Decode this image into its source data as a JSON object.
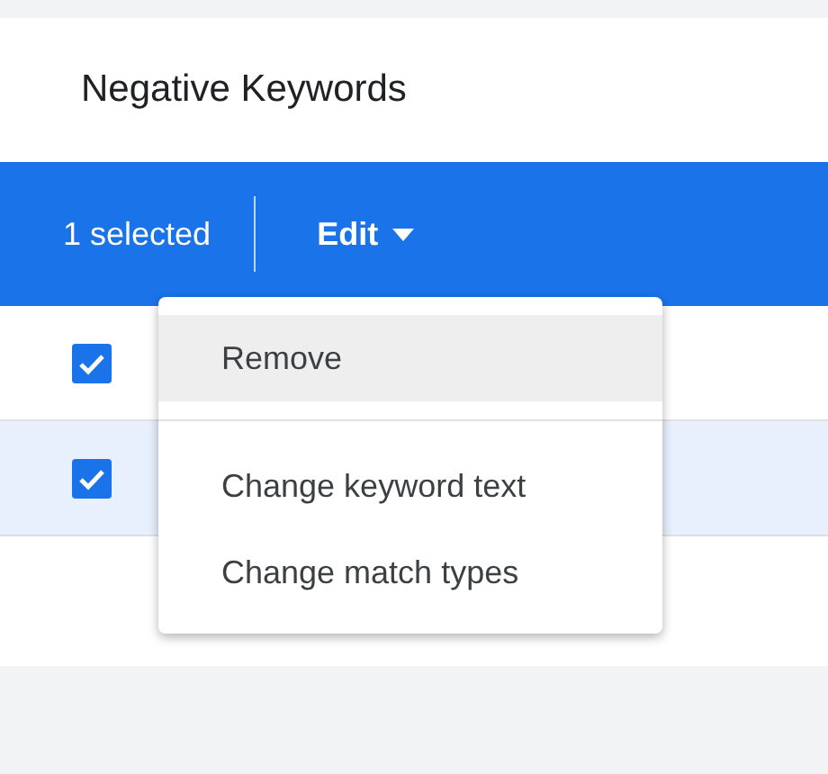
{
  "title": "Negative Keywords",
  "toolbar": {
    "selection_count": "1 selected",
    "edit_menu": {
      "label": "Edit",
      "expanded": true
    }
  },
  "rows": [
    {
      "checked": true,
      "highlighted": false
    },
    {
      "checked": true,
      "highlighted": true
    }
  ],
  "menu": {
    "groups": [
      {
        "items": [
          {
            "label": "Remove",
            "highlighted": true
          }
        ]
      },
      {
        "items": [
          {
            "label": "Change keyword text",
            "highlighted": false
          },
          {
            "label": "Change match types",
            "highlighted": false
          }
        ]
      }
    ]
  }
}
